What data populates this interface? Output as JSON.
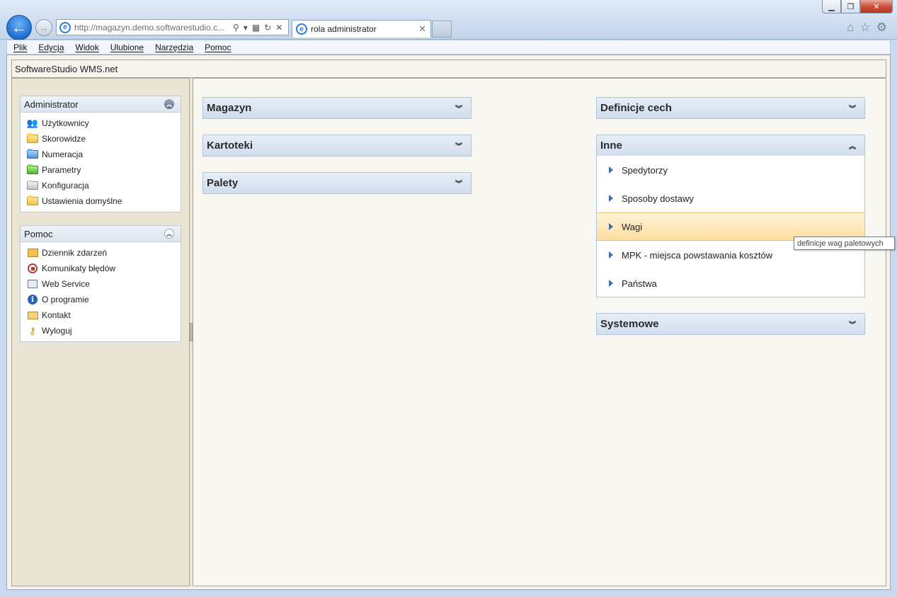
{
  "browser": {
    "address_url": "http://magazyn.demo.softwarestudio.c...",
    "tab_title": "rola administrator",
    "menu": [
      "Plik",
      "Edycja",
      "Widok",
      "Ulubione",
      "Narzędzia",
      "Pomoc"
    ]
  },
  "app": {
    "title": "SoftwareStudio WMS.net"
  },
  "sidebar": {
    "administrator": {
      "title": "Administrator",
      "items": [
        {
          "label": "Użytkownicy",
          "icon": "users-icon"
        },
        {
          "label": "Skorowidze",
          "icon": "folder-yellow-icon"
        },
        {
          "label": "Numeracja",
          "icon": "folder-blue-icon"
        },
        {
          "label": "Parametry",
          "icon": "folder-green-icon"
        },
        {
          "label": "Konfiguracja",
          "icon": "folder-gray-icon"
        },
        {
          "label": "Ustawienia domyślne",
          "icon": "folder-yellow-icon"
        }
      ]
    },
    "pomoc": {
      "title": "Pomoc",
      "items": [
        {
          "label": "Dziennik zdarzeń",
          "icon": "log-icon"
        },
        {
          "label": "Komunikaty błędów",
          "icon": "stop-icon"
        },
        {
          "label": "Web Service",
          "icon": "web-service-icon"
        },
        {
          "label": "O programie",
          "icon": "info-icon"
        },
        {
          "label": "Kontakt",
          "icon": "mail-icon"
        },
        {
          "label": "Wyloguj",
          "icon": "key-icon"
        }
      ]
    }
  },
  "main": {
    "left_panels": [
      "Magazyn",
      "Kartoteki",
      "Palety"
    ],
    "right_panels": {
      "definicje": "Definicje cech",
      "inne": {
        "title": "Inne",
        "items": [
          "Spedytorzy",
          "Sposoby dostawy",
          "Wagi",
          "MPK - miejsca powstawania kosztów",
          "Państwa"
        ]
      },
      "systemowe": "Systemowe"
    }
  },
  "tooltip": "definicje wag paletowych",
  "colors": {
    "accent": "#1d6ed2",
    "panel_header": "#d1ddee",
    "hover_item": "#ffdda0",
    "sidebar_bg": "#e9e4d3"
  }
}
